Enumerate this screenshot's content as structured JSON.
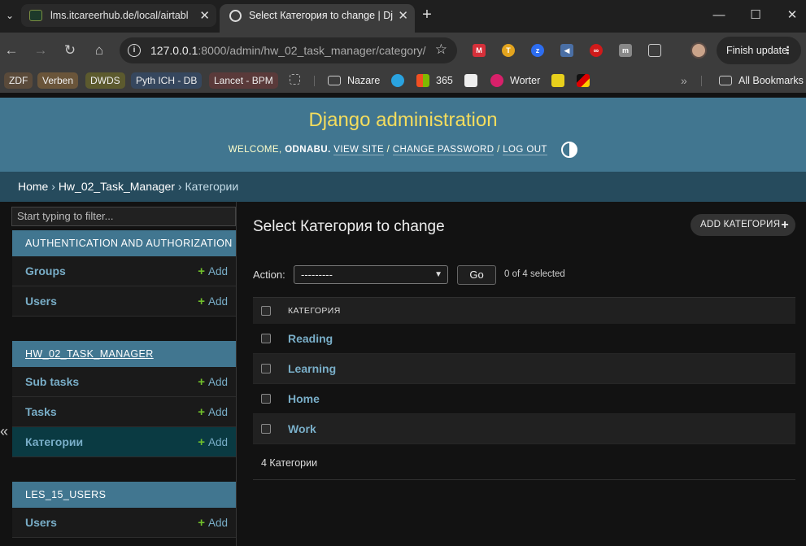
{
  "browser": {
    "tabs": [
      {
        "title": "lms.itcareerhub.de/local/airtabl"
      },
      {
        "title": "Select Категория to change | Dj"
      }
    ],
    "url": {
      "host": "127.0.0.1",
      "path": ":8000/admin/hw_02_task_manager/category/"
    },
    "finish_update": "Finish update",
    "bookmarks": [
      {
        "label": "ZDF",
        "color": "#5a4a3a"
      },
      {
        "label": "Verben",
        "color": "#6a553a"
      },
      {
        "label": "DWDS",
        "color": "#5c5a2e"
      },
      {
        "label": "Pyth ICH - DB",
        "color": "#36475e"
      },
      {
        "label": "Lancet - BPM",
        "color": "#5a3a3a"
      }
    ],
    "bookmark_items": [
      "Nazare",
      "365",
      "Worter",
      "All Bookmarks"
    ]
  },
  "admin": {
    "site_title": "Django administration",
    "welcome": "WELCOME,",
    "username": "ODNABU.",
    "view_site": "VIEW SITE",
    "change_password": "CHANGE PASSWORD",
    "log_out": "LOG OUT",
    "breadcrumb": {
      "home": "Home",
      "app": "Hw_02_Task_Manager",
      "current": "Категории"
    },
    "filter_placeholder": "Start typing to filter...",
    "modules": [
      {
        "caption": "AUTHENTICATION AND AUTHORIZATION",
        "models": [
          "Groups",
          "Users"
        ]
      },
      {
        "caption": "HW_02_TASK_MANAGER",
        "models": [
          "Sub tasks",
          "Tasks",
          "Категории"
        ]
      },
      {
        "caption": "LES_15_USERS",
        "models": [
          "Users"
        ]
      }
    ],
    "add_label": "Add",
    "page_title": "Select Категория to change",
    "add_button": "ADD КАТЕГОРИЯ",
    "action_label": "Action:",
    "action_value": "---------",
    "go": "Go",
    "selected": "0 of 4 selected",
    "column_header": "КАТЕГОРИЯ",
    "rows": [
      "Reading",
      "Learning",
      "Home",
      "Work"
    ],
    "count": "4 Категории"
  },
  "colors": {
    "header": "#417690",
    "title": "#f5dd5d",
    "link": "#79aec8",
    "add": "#70bf2b"
  }
}
